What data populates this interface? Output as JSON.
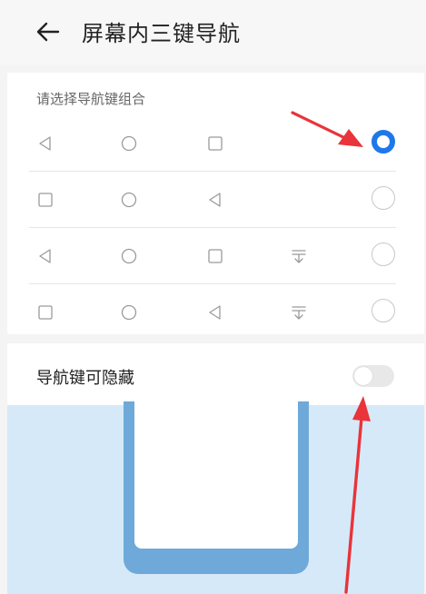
{
  "header": {
    "title": "屏幕内三键导航",
    "back_icon": "arrow-left-icon"
  },
  "nav_combinations": {
    "section_title": "请选择导航键组合",
    "options": [
      {
        "keys": [
          "back-triangle-icon",
          "home-circle-icon",
          "recents-square-icon"
        ],
        "selected": true
      },
      {
        "keys": [
          "recents-square-icon",
          "home-circle-icon",
          "back-triangle-icon"
        ],
        "selected": false
      },
      {
        "keys": [
          "back-triangle-icon",
          "home-circle-icon",
          "recents-square-icon",
          "notification-pulldown-icon"
        ],
        "selected": false
      },
      {
        "keys": [
          "recents-square-icon",
          "home-circle-icon",
          "back-triangle-icon",
          "notification-pulldown-icon"
        ],
        "selected": false
      }
    ]
  },
  "hide_nav_keys": {
    "label": "导航键可隐藏",
    "enabled": false
  },
  "colors": {
    "accent": "#1f78ea",
    "annotation_arrow": "#e8343a",
    "illustration_bg": "#d6e9f8",
    "phone_frame": "#6ea9d9"
  }
}
